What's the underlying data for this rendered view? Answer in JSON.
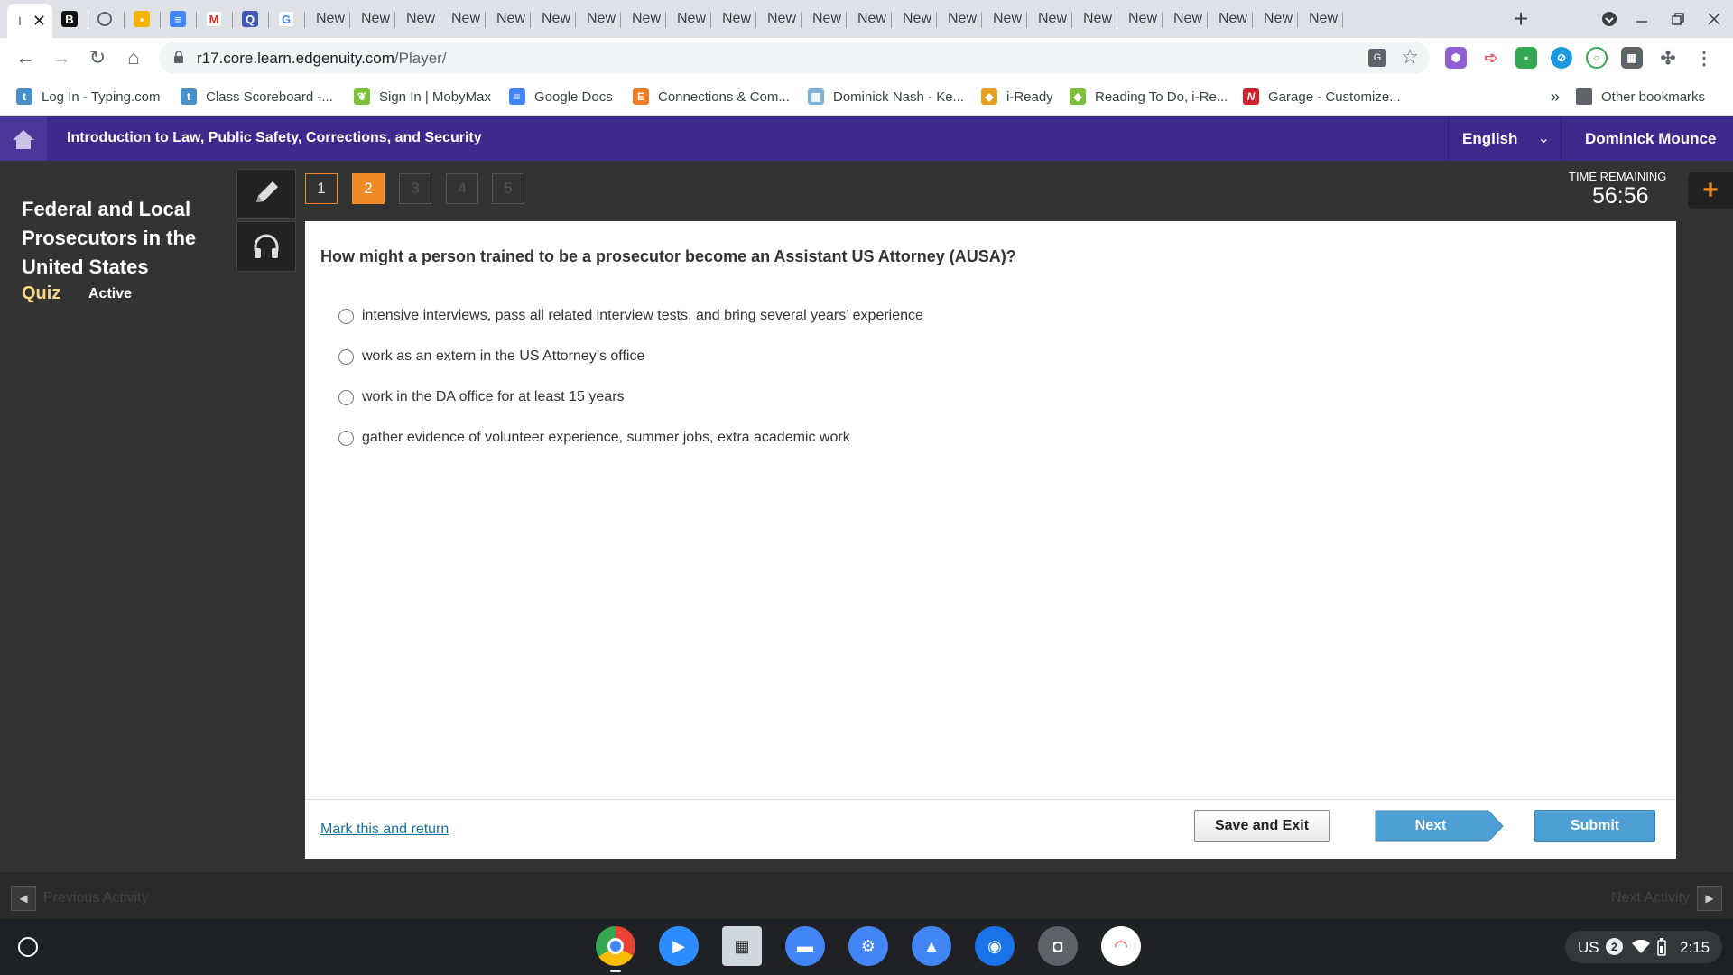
{
  "browser": {
    "tabs": [
      {
        "label": "I",
        "icon": "edgenuity-icon"
      },
      {
        "label": "",
        "icon": "b-icon"
      },
      {
        "label": "",
        "icon": "circle-icon"
      },
      {
        "label": "",
        "icon": "classroom-icon"
      },
      {
        "label": "",
        "icon": "docs-icon"
      },
      {
        "label": "",
        "icon": "gmail-icon"
      },
      {
        "label": "",
        "icon": "quizlet-icon"
      },
      {
        "label": "",
        "icon": "google-icon"
      },
      {
        "label": "New"
      },
      {
        "label": "New"
      },
      {
        "label": "New"
      },
      {
        "label": "New"
      },
      {
        "label": "New"
      },
      {
        "label": "New"
      },
      {
        "label": "New"
      },
      {
        "label": "New"
      },
      {
        "label": "New"
      },
      {
        "label": "New"
      },
      {
        "label": "New"
      },
      {
        "label": "New"
      },
      {
        "label": "New"
      },
      {
        "label": "New"
      },
      {
        "label": "New"
      },
      {
        "label": "New"
      },
      {
        "label": "New"
      },
      {
        "label": "New"
      },
      {
        "label": "New"
      },
      {
        "label": "New"
      },
      {
        "label": "New"
      },
      {
        "label": "New"
      },
      {
        "label": "New"
      }
    ],
    "url_host": "r17.core.learn.edgenuity.com",
    "url_path": "/Player/",
    "bookmarks": [
      {
        "label": "Log In - Typing.com",
        "color": "#4a90c8",
        "glyph": "t"
      },
      {
        "label": "Class Scoreboard -...",
        "color": "#4a90c8",
        "glyph": "t"
      },
      {
        "label": "Sign In | MobyMax",
        "color": "#7bbf3a",
        "glyph": "❦"
      },
      {
        "label": "Google Docs",
        "color": "#4285f4",
        "glyph": "≡"
      },
      {
        "label": "Connections & Com...",
        "color": "#f07c24",
        "glyph": "E"
      },
      {
        "label": "Dominick Nash - Ke...",
        "color": "#7fb2d8",
        "glyph": "▦"
      },
      {
        "label": "i-Ready",
        "color": "#e8a020",
        "glyph": "◆"
      },
      {
        "label": "Reading To Do, i-Re...",
        "color": "#7bbf3a",
        "glyph": "◆"
      },
      {
        "label": "Garage - Customize...",
        "color": "#d0202c",
        "glyph": "N"
      }
    ],
    "bookmarks_overflow": "»",
    "other_bookmarks": "Other bookmarks"
  },
  "header": {
    "course_title": "Introduction to Law, Public Safety, Corrections, and Security",
    "language": "English",
    "user": "Dominick Mounce"
  },
  "sidebar": {
    "lesson_title": "Federal and Local Prosecutors in the United States",
    "type_label": "Quiz",
    "status_label": "Active"
  },
  "question_nav": {
    "numbers": [
      "1",
      "2",
      "3",
      "4",
      "5"
    ],
    "current": "2"
  },
  "timer": {
    "label": "TIME REMAINING",
    "value": "56:56"
  },
  "question": {
    "text": "How might a person trained to be a prosecutor become an Assistant US Attorney (AUSA)?",
    "choices": [
      "intensive interviews, pass all related interview tests, and bring several years’ experience",
      "work as an extern in the US Attorney’s office",
      "work in the DA office for at least 15 years",
      "gather evidence of volunteer experience, summer jobs, extra academic work"
    ]
  },
  "footer": {
    "mark_return": "Mark this and return",
    "save_exit": "Save and Exit",
    "next": "Next",
    "submit": "Submit"
  },
  "activity_nav": {
    "previous": "Previous Activity",
    "next": "Next Activity"
  },
  "shelf": {
    "apps": [
      "chrome-icon",
      "zoom-icon",
      "photos-icon",
      "files-icon",
      "settings-icon",
      "gallery-icon",
      "eye-icon",
      "camera-icon",
      "rainbow-icon"
    ],
    "tray": {
      "lang": "US",
      "notifications": "2",
      "time": "2:15"
    }
  },
  "colors": {
    "header_bg": "#3c2a8c",
    "accent_orange": "#f08a24",
    "button_blue": "#4d9fd4"
  }
}
